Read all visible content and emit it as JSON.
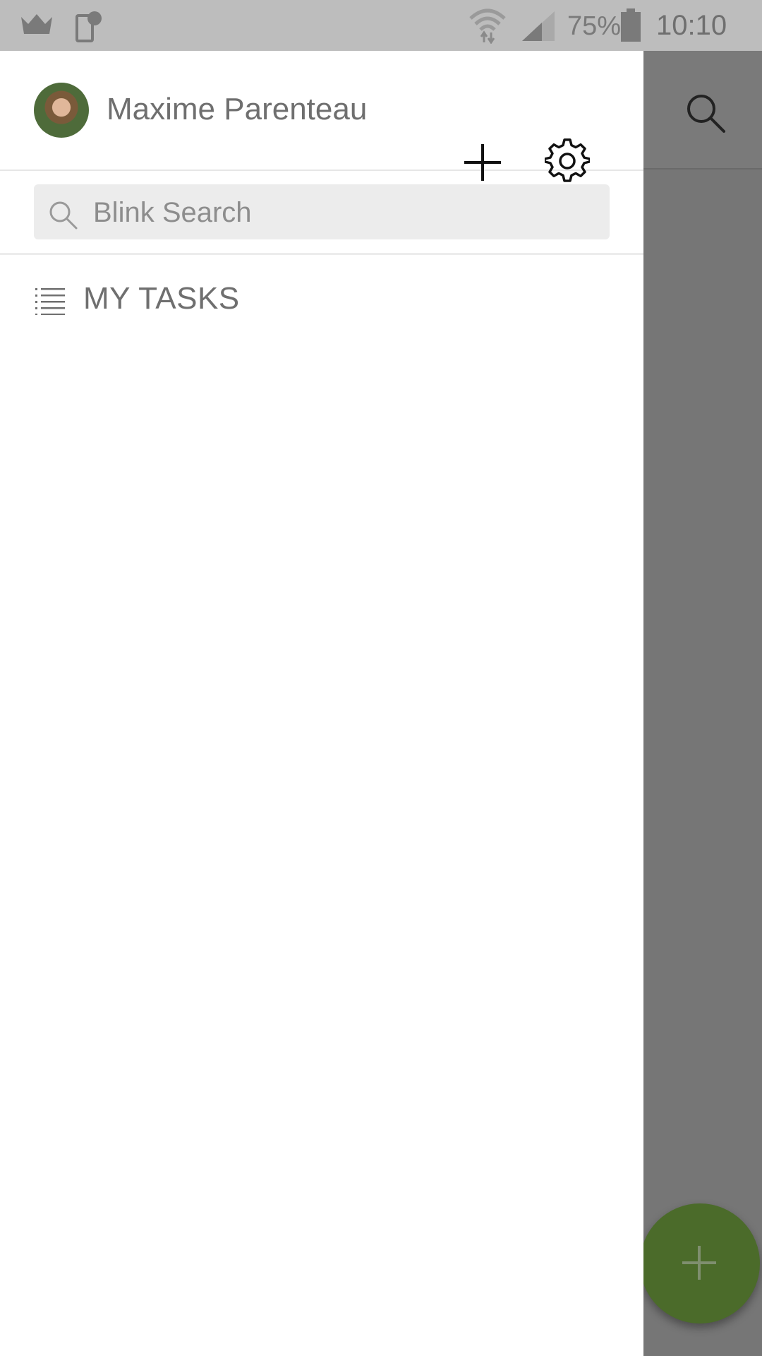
{
  "status_bar": {
    "battery_percent": "75%",
    "time": "10:10",
    "icons": [
      "crown-icon",
      "device-notification-icon",
      "wifi-icon",
      "cell-signal-icon",
      "battery-icon"
    ]
  },
  "drawer": {
    "user_name": "Maxime Parenteau",
    "search_placeholder": "Blink Search",
    "nav_items": [
      {
        "label": "MY TASKS",
        "icon": "list-icon"
      }
    ]
  },
  "colors": {
    "status_bar_bg": "#bdbdbd",
    "scrim": "#7a7a7a",
    "fab": "#4b6b2a",
    "drawer_bg": "#ffffff",
    "search_bg": "#ececec"
  }
}
